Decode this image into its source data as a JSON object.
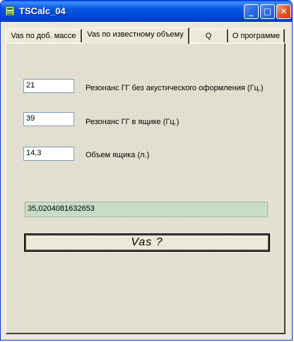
{
  "window": {
    "title": "TSCalc_04"
  },
  "titlebar_buttons": {
    "minimize": "_",
    "maximize": "□",
    "close": "✕"
  },
  "tabs": [
    {
      "label": "Vas по доб. массе"
    },
    {
      "label": "Vas по известному объему"
    },
    {
      "label": "Q"
    },
    {
      "label": "О программе"
    }
  ],
  "form": {
    "f0_value": "21",
    "f0_label": "Резонанс ГГ без акустического оформления (Гц.)",
    "fc_value": "39",
    "fc_label": "Резонанс ГГ в ящике (Гц.)",
    "vb_value": "14,3",
    "vb_label": "Объем ящика (л.)",
    "result": "35,0204081632653",
    "calc_label": "Vas ?"
  },
  "colors": {
    "titlebar": "#0a5ae6",
    "result_bg": "#c8dcc8",
    "window_bg": "#ece9d8"
  }
}
